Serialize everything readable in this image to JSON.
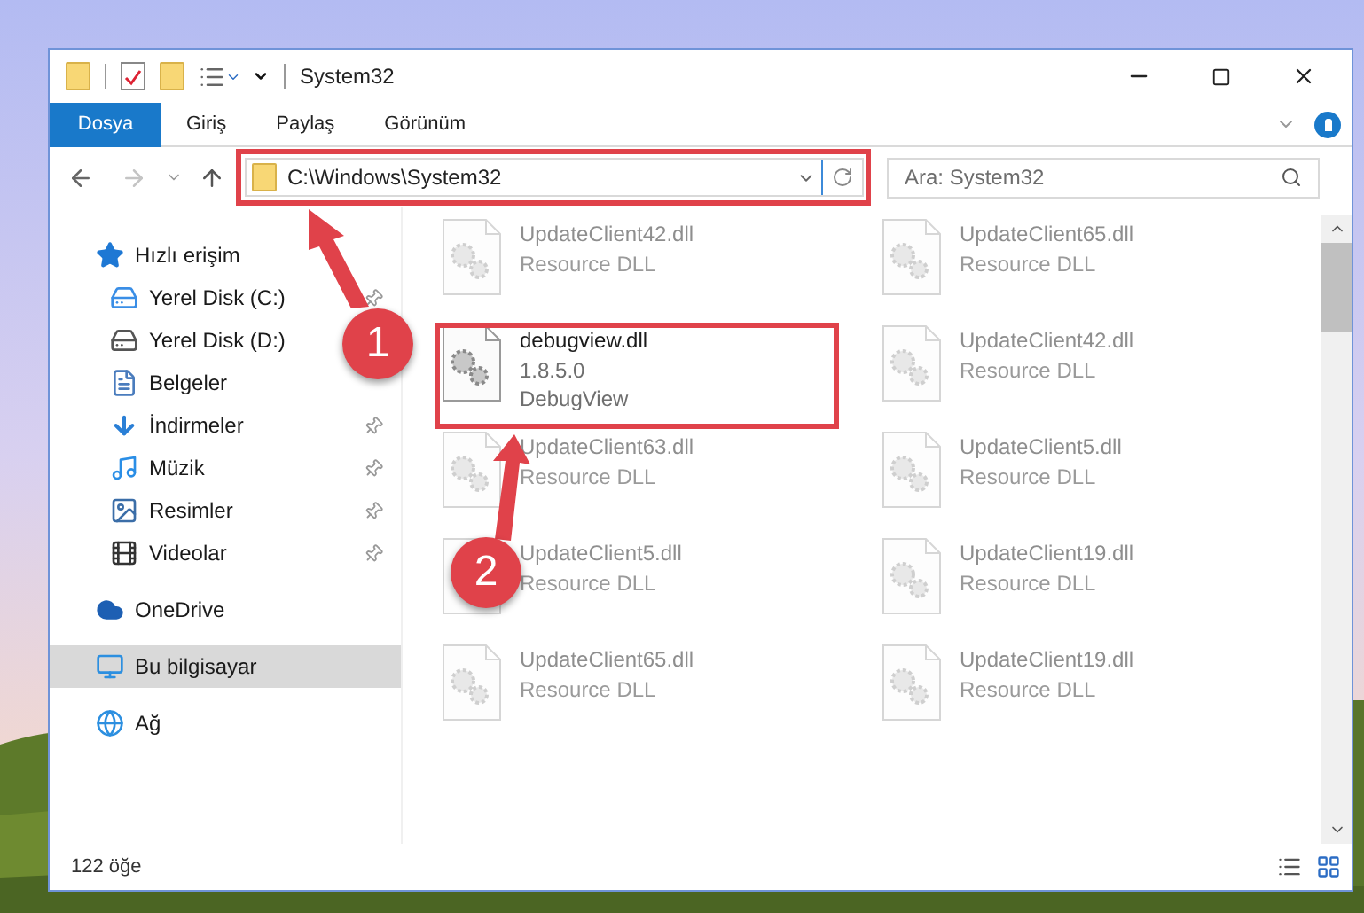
{
  "window": {
    "title": "System32"
  },
  "ribbon_tabs": [
    {
      "label": "Dosya",
      "selected": true
    },
    {
      "label": "Giriş",
      "selected": false
    },
    {
      "label": "Paylaş",
      "selected": false
    },
    {
      "label": "Görünüm",
      "selected": false
    }
  ],
  "address_bar": {
    "path": "C:\\Windows\\System32"
  },
  "search": {
    "placeholder": "Ara: System32"
  },
  "nav_pane": [
    {
      "label": "Hızlı erişim",
      "kind": "star",
      "selected": false,
      "children": [
        {
          "label": "Yerel Disk (C:)",
          "kind": "system-drive",
          "pinned": true,
          "selected": false
        },
        {
          "label": "Yerel Disk (D:)",
          "kind": "drive",
          "pinned": false,
          "selected": false
        },
        {
          "label": "Belgeler",
          "kind": "documents",
          "pinned": false,
          "selected": false
        },
        {
          "label": "İndirmeler",
          "kind": "download",
          "pinned": true,
          "selected": false
        },
        {
          "label": "Müzik",
          "kind": "music",
          "pinned": true,
          "selected": false
        },
        {
          "label": "Resimler",
          "kind": "pictures",
          "pinned": true,
          "selected": false
        },
        {
          "label": "Videolar",
          "kind": "videos",
          "pinned": true,
          "selected": false
        }
      ]
    },
    {
      "label": "OneDrive",
      "kind": "cloud",
      "selected": false
    },
    {
      "label": "Bu bilgisayar",
      "kind": "computer",
      "selected": true
    },
    {
      "label": "Ağ",
      "kind": "network",
      "selected": false
    }
  ],
  "files": [
    {
      "name": "UpdateClient42.dll",
      "lines": [
        "Resource DLL"
      ],
      "blurred": true
    },
    {
      "name": "UpdateClient65.dll",
      "lines": [
        "Resource DLL"
      ],
      "blurred": true
    },
    {
      "name": "debugview.dll",
      "lines": [
        "1.8.5.0",
        "DebugView"
      ],
      "blurred": false
    },
    {
      "name": "UpdateClient42.dll",
      "lines": [
        "Resource DLL"
      ],
      "blurred": true
    },
    {
      "name": "UpdateClient63.dll",
      "lines": [
        "Resource DLL"
      ],
      "blurred": true
    },
    {
      "name": "UpdateClient5.dll",
      "lines": [
        "Resource DLL"
      ],
      "blurred": true
    },
    {
      "name": "UpdateClient5.dll",
      "lines": [
        "Resource DLL"
      ],
      "blurred": true
    },
    {
      "name": "UpdateClient19.dll",
      "lines": [
        "Resource DLL"
      ],
      "blurred": true
    },
    {
      "name": "UpdateClient65.dll",
      "lines": [
        "Resource DLL"
      ],
      "blurred": true
    },
    {
      "name": "UpdateClient19.dll",
      "lines": [
        "Resource DLL"
      ],
      "blurred": true
    }
  ],
  "status_bar": {
    "count": "122 öğe"
  },
  "annotations": [
    {
      "label": "1"
    },
    {
      "label": "2"
    }
  ]
}
